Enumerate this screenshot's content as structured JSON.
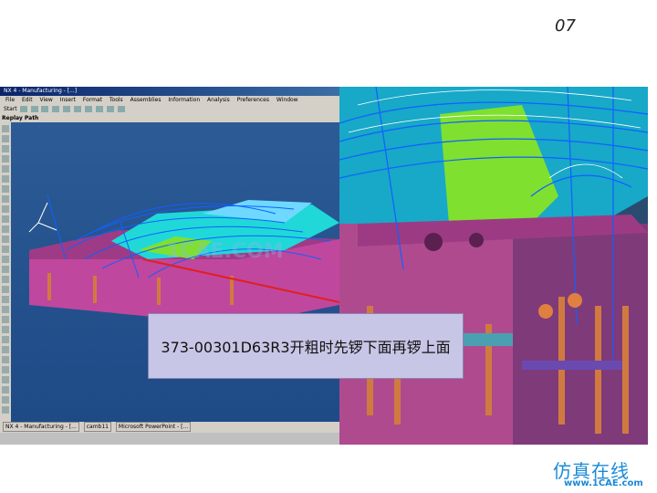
{
  "slide": {
    "page_number": "07"
  },
  "nx_window": {
    "title": "NX 4 - Manufacturing - [...]",
    "menu": [
      "File",
      "Edit",
      "View",
      "Insert",
      "Format",
      "Tools",
      "Assemblies",
      "Information",
      "Analysis",
      "Preferences",
      "Window"
    ],
    "start_label": "Start",
    "panel_label": "Replay Path",
    "taskbar_items": [
      "NX 4 - Manufacturing - [...",
      "camb11",
      "Microsoft PowerPoint - [..."
    ],
    "watermark": "1CAE.COM"
  },
  "callout": {
    "text": "373-00301D63R3开粗时先锣下面再锣上面"
  },
  "branding": {
    "name": "仿真在线",
    "url": "www.1CAE.com"
  },
  "colors": {
    "viewport_bg": "#2c5b95",
    "callout_bg": "#c7c6e6",
    "mold_magenta": "#c0479e",
    "mold_cyan": "#20d8d8",
    "mold_green": "#7fe030",
    "toolpath_blue": "#1060ff",
    "arrow_red": "#e02020"
  }
}
